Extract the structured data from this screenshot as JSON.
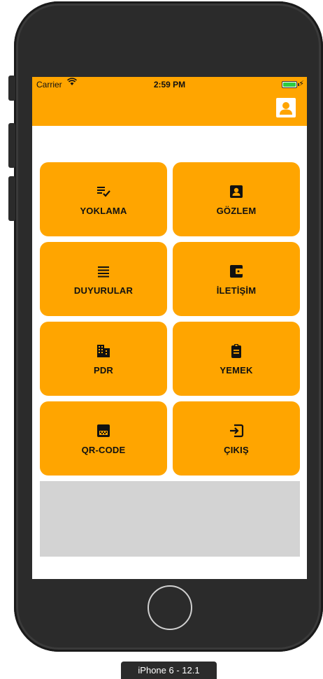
{
  "status_bar": {
    "carrier": "Carrier",
    "wifi_icon": "wifi-icon",
    "time": "2:59 PM",
    "battery_icon": "battery-charging-icon"
  },
  "nav_bar": {
    "background_color": "#FFA500",
    "profile_icon": "profile-icon"
  },
  "menu": {
    "tile_color": "#FFA500",
    "items": [
      {
        "label": "YOKLAMA",
        "icon": "checklist-icon"
      },
      {
        "label": "GÖZLEM",
        "icon": "contact-card-icon"
      },
      {
        "label": "DUYURULAR",
        "icon": "lines-icon"
      },
      {
        "label": "İLETİŞİM",
        "icon": "wallet-icon"
      },
      {
        "label": "PDR",
        "icon": "building-icon"
      },
      {
        "label": "YEMEK",
        "icon": "clipboard-icon"
      },
      {
        "label": "QR-CODE",
        "icon": "qr-code-icon"
      },
      {
        "label": "ÇIKIŞ",
        "icon": "exit-icon"
      }
    ]
  },
  "device_label": "iPhone 6 - 12.1"
}
